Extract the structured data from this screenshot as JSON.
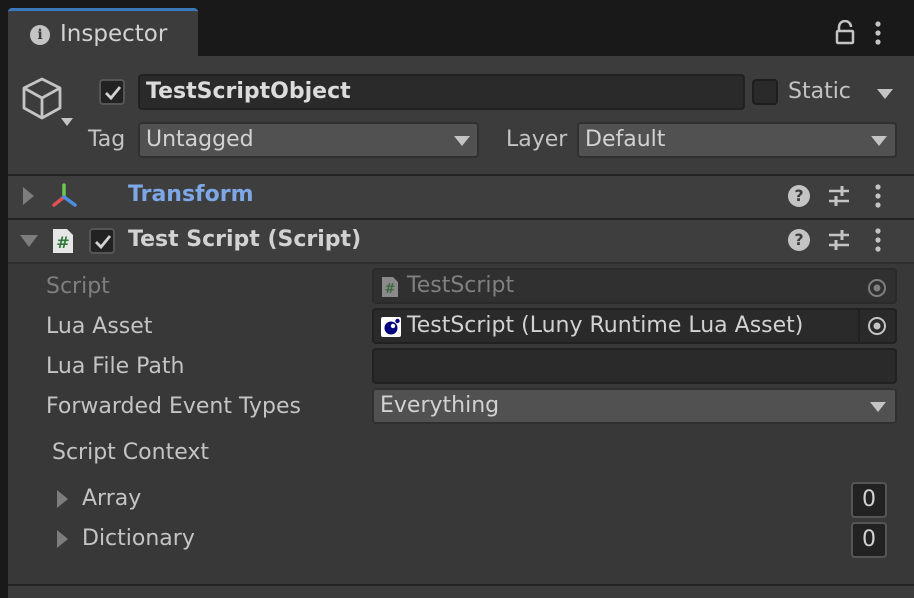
{
  "tab": {
    "title": "Inspector"
  },
  "header": {
    "object_name": "TestScriptObject",
    "active": true,
    "static_label": "Static",
    "static_checked": false,
    "tag_label": "Tag",
    "tag_value": "Untagged",
    "layer_label": "Layer",
    "layer_value": "Default"
  },
  "components": {
    "transform": {
      "title": "Transform"
    },
    "test_script": {
      "title": "Test Script (Script)",
      "enabled": true
    }
  },
  "properties": {
    "script": {
      "label": "Script",
      "value": "TestScript"
    },
    "lua_asset": {
      "label": "Lua Asset",
      "value": "TestScript (Luny Runtime Lua Asset)"
    },
    "lua_file_path": {
      "label": "Lua File Path",
      "value": ""
    },
    "forwarded_event_types": {
      "label": "Forwarded Event Types",
      "value": "Everything"
    }
  },
  "script_context": {
    "label": "Script Context",
    "array": {
      "label": "Array",
      "count": "0"
    },
    "dictionary": {
      "label": "Dictionary",
      "count": "0"
    }
  },
  "colors": {
    "accent_tab": "#3a79bb",
    "transform_title": "#7ea7e6",
    "panel_bg": "#383838",
    "header_bg": "#3c3c3c"
  },
  "icons": [
    "info-icon",
    "lock-icon",
    "kebab-menu-icon",
    "cube-icon",
    "transform-axes-icon",
    "script-hash-icon",
    "help-icon",
    "presets-icon",
    "lua-asset-icon",
    "object-picker-icon"
  ]
}
